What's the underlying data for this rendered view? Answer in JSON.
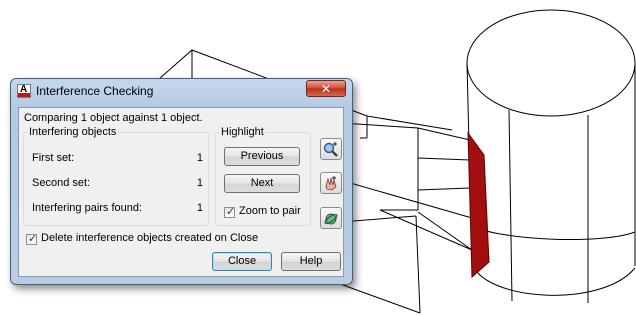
{
  "window": {
    "title": "Interference Checking",
    "app_icon_glyph": "A",
    "close_glyph": "✕"
  },
  "status_line": "Comparing 1 object against 1 object.",
  "interfering_objects": {
    "label": "Interfering objects",
    "rows": [
      {
        "label": "First set:",
        "value": "1"
      },
      {
        "label": "Second set:",
        "value": "1"
      },
      {
        "label": "Interfering pairs found:",
        "value": "1"
      }
    ]
  },
  "highlight": {
    "label": "Highlight",
    "previous_label": "Previous",
    "next_label": "Next",
    "zoom_to_pair": {
      "label": "Zoom to pair",
      "checked": true
    }
  },
  "side_tools": [
    {
      "icon": "zoom-realtime-icon"
    },
    {
      "icon": "pan-icon"
    },
    {
      "icon": "3d-orbit-icon"
    }
  ],
  "delete_objects": {
    "label": "Delete interference objects created on Close",
    "checked": true
  },
  "buttons": {
    "close_label": "Close",
    "help_label": "Help"
  },
  "colors": {
    "interference_solid": "#a30f0f",
    "title_bar": "#c5d7ec",
    "close_button": "#cf4a33"
  }
}
